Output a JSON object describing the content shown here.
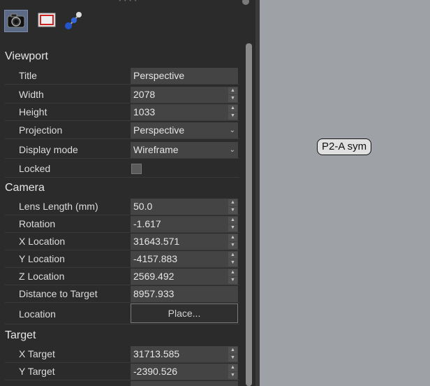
{
  "toolbar": {
    "icons": [
      "camera-icon",
      "frame-icon",
      "molecule-icon"
    ]
  },
  "sections": {
    "viewport": "Viewport",
    "camera": "Camera",
    "target": "Target"
  },
  "viewport": {
    "title": {
      "label": "Title",
      "value": "Perspective"
    },
    "width": {
      "label": "Width",
      "value": "2078"
    },
    "height": {
      "label": "Height",
      "value": "1033"
    },
    "projection": {
      "label": "Projection",
      "value": "Perspective"
    },
    "display_mode": {
      "label": "Display mode",
      "value": "Wireframe"
    },
    "locked": {
      "label": "Locked",
      "checked": false
    }
  },
  "camera": {
    "lens_length": {
      "label": "Lens Length (mm)",
      "value": "50.0"
    },
    "rotation": {
      "label": "Rotation",
      "value": "-1.617"
    },
    "x_location": {
      "label": "X Location",
      "value": "31643.571"
    },
    "y_location": {
      "label": "Y Location",
      "value": "-4157.883"
    },
    "z_location": {
      "label": "Z Location",
      "value": "2569.492"
    },
    "distance": {
      "label": "Distance to Target",
      "value": "8957.933"
    },
    "location": {
      "label": "Location",
      "button": "Place..."
    }
  },
  "target": {
    "x_target": {
      "label": "X Target",
      "value": "31713.585"
    },
    "y_target": {
      "label": "Y Target",
      "value": "-2390.526"
    }
  },
  "canvas": {
    "tag": "P2-A sym"
  }
}
